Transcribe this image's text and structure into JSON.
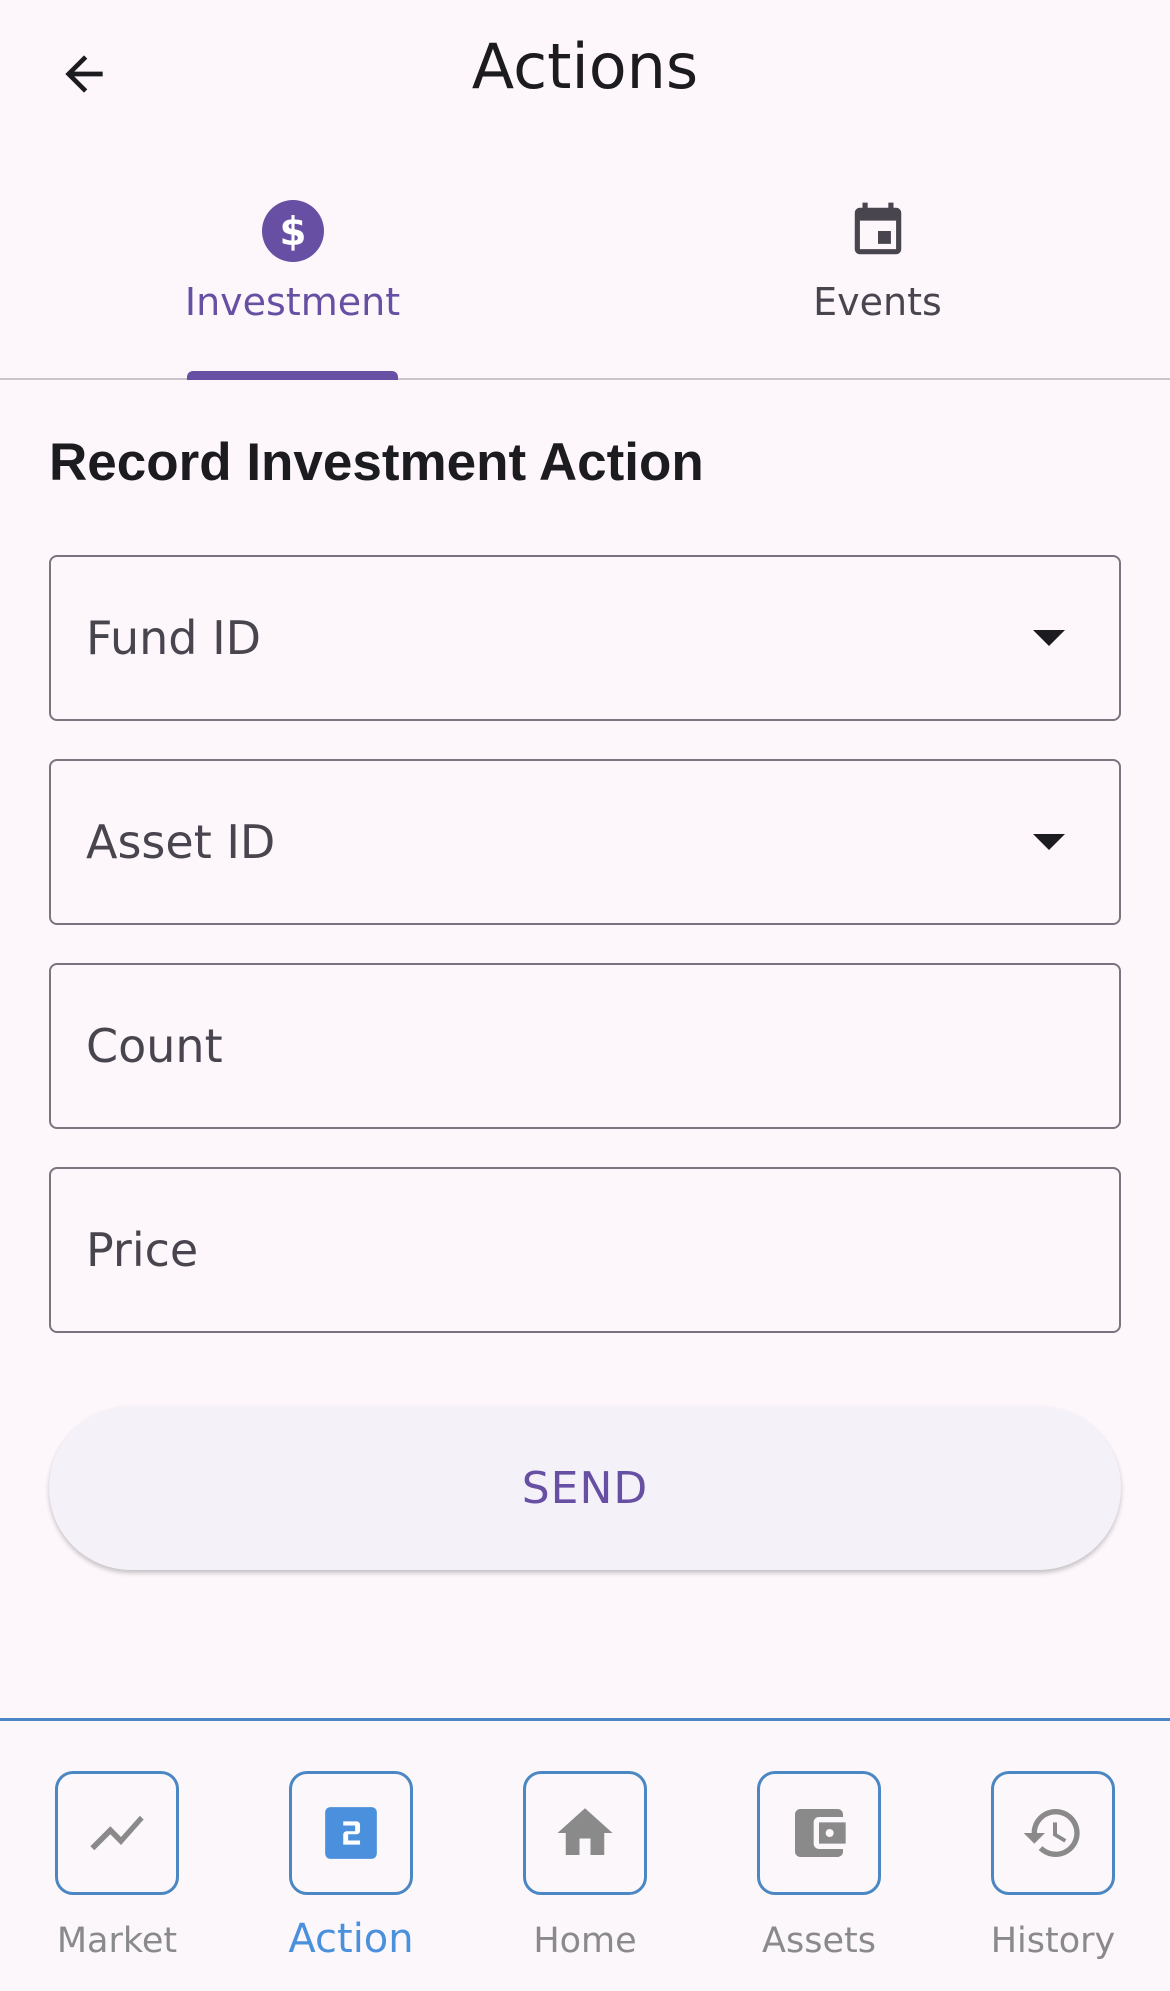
{
  "appbar": {
    "title": "Actions"
  },
  "tabs": [
    {
      "label": "Investment",
      "icon": "dollar-circle-icon",
      "selected": true
    },
    {
      "label": "Events",
      "icon": "calendar-event-icon",
      "selected": false
    }
  ],
  "form": {
    "title": "Record Investment Action",
    "fields": {
      "fund_id": {
        "label": "Fund ID",
        "type": "dropdown"
      },
      "asset_id": {
        "label": "Asset ID",
        "type": "dropdown"
      },
      "count": {
        "label": "Count",
        "type": "text"
      },
      "price": {
        "label": "Price",
        "type": "text"
      }
    },
    "send_label": "SEND"
  },
  "bottom_nav": {
    "items": [
      {
        "label": "Market",
        "icon": "trending-line-icon",
        "active": false
      },
      {
        "label": "Action",
        "icon": "number-2-icon",
        "active": true
      },
      {
        "label": "Home",
        "icon": "home-icon",
        "active": false
      },
      {
        "label": "Assets",
        "icon": "wallet-icon",
        "active": false
      },
      {
        "label": "History",
        "icon": "history-icon",
        "active": false
      }
    ]
  },
  "colors": {
    "primary": "#6750a4",
    "nav_accent": "#4b87c2",
    "nav_active_icon": "#4b90dc",
    "background": "#fdf7fc"
  }
}
